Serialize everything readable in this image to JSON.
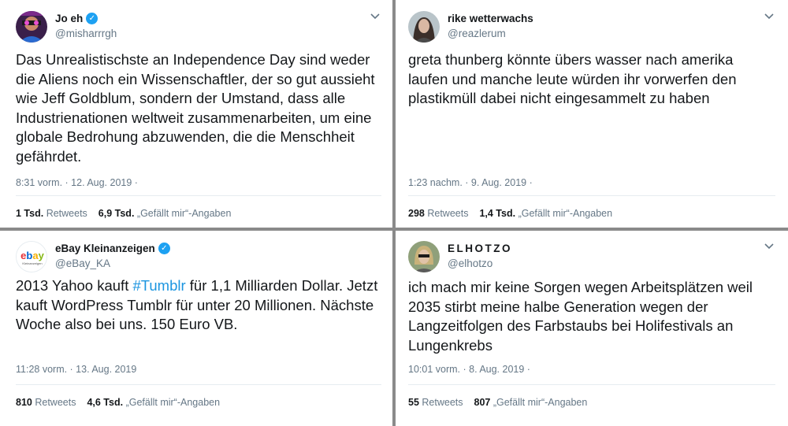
{
  "tweets": [
    {
      "name": "Jo eh",
      "handle": "@misharrrgh",
      "verified": true,
      "text": "Das Unrealistischste an Independence Day sind weder die Aliens noch ein Wissenschaftler, der so gut aussieht wie Jeff Goldblum, sondern der Umstand, dass alle Industrienationen weltweit zusammenarbeiten, um eine globale Bedrohung abzuwenden, die die Menschheit gefährdet.",
      "time": "8:31 vorm. · 12. Aug. 2019 ·",
      "retweets_count": "1 Tsd.",
      "retweets_label": "Retweets",
      "likes_count": "6,9 Tsd.",
      "likes_label": "„Gefällt mir“-Angaben",
      "avatar_icon": "avatar-photo-icon"
    },
    {
      "name": "rike wetterwachs",
      "handle": "@reazlerum",
      "verified": false,
      "text": "greta thunberg könnte übers wasser nach amerika laufen und manche leute würden ihr vorwerfen den plastikmüll dabei nicht eingesammelt zu haben",
      "time": "1:23 nachm. · 9. Aug. 2019 ·",
      "retweets_count": "298",
      "retweets_label": "Retweets",
      "likes_count": "1,4 Tsd.",
      "likes_label": "„Gefällt mir“-Angaben",
      "avatar_icon": "avatar-photo-icon"
    },
    {
      "name": "eBay Kleinanzeigen",
      "handle": "@eBay_KA",
      "verified": true,
      "text_before": "2013 Yahoo kauft ",
      "hashtag": "#Tumblr",
      "text_after": " für 1,1 Milliarden Dollar. Jetzt kauft WordPress Tumblr für unter 20 Millionen. Nächste Woche also bei uns. 150 Euro VB.",
      "time": "11:28 vorm. · 13. Aug. 2019",
      "retweets_count": "810",
      "retweets_label": "Retweets",
      "likes_count": "4,6 Tsd.",
      "likes_label": "„Gefällt mir“-Angaben",
      "avatar_icon": "ebay-logo-icon",
      "logo_text": "ebay",
      "logo_subtext": "Kleinanzeigen"
    },
    {
      "name": "ELHOTZO",
      "handle": "@elhotzo",
      "verified": false,
      "text": "ich mach mir keine Sorgen wegen Arbeitsplätzen weil 2035 stirbt meine halbe Generation wegen der Langzeitfolgen des Farbstaubs bei Holifestivals an Lungenkrebs",
      "time": "10:01 vorm. · 8. Aug. 2019 ·",
      "retweets_count": "55",
      "retweets_label": "Retweets",
      "likes_count": "807",
      "likes_label": "„Gefällt mir“-Angaben",
      "avatar_icon": "avatar-photo-icon"
    }
  ],
  "colors": {
    "text": "#14171a",
    "secondary": "#657786",
    "link": "#1b95e0",
    "verified": "#1da1f2",
    "separator": "#8a8a8a"
  },
  "icons": {
    "verified": "verified-badge-icon",
    "menu": "chevron-down-icon"
  }
}
